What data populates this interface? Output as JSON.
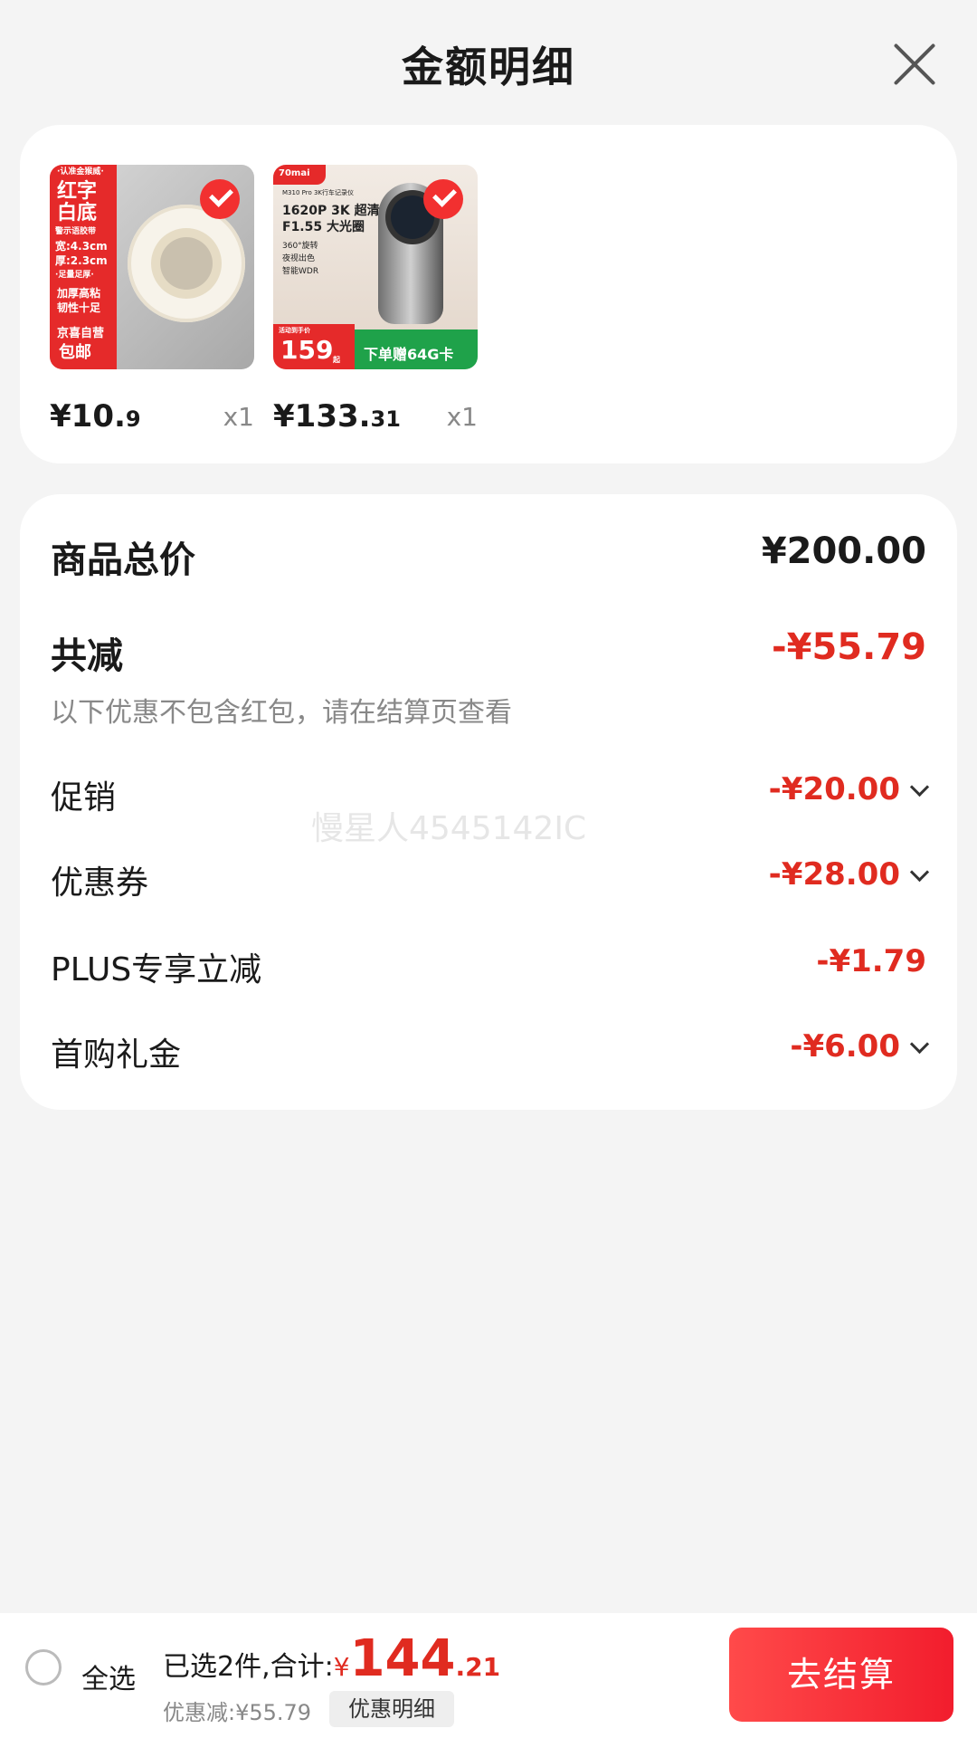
{
  "header": {
    "title": "金额明细"
  },
  "products": [
    {
      "price_int": "¥10.",
      "price_dec": "9",
      "qty": "x1",
      "image_text": [
        "·认准金猴威·",
        "红字",
        "白底",
        "警示语胶带",
        "宽:4.3cm",
        "厚:2.3cm",
        "·足量足厚·",
        "加厚高粘",
        "韧性十足",
        "京喜自营",
        "包邮"
      ]
    },
    {
      "price_int": "¥133.",
      "price_dec": "31",
      "qty": "x1",
      "image_text": [
        "70mai",
        "M310 Pro 3K行车记录仪",
        "1620P 3K 超清",
        "F1.55 大光圈",
        "360°旋转",
        "夜视出色",
        "智能WDR",
        "活动到手价",
        "159",
        "起",
        "下单赠64G卡"
      ]
    }
  ],
  "summary": {
    "total_label": "商品总价",
    "total_value": "¥200.00",
    "reduce_label": "共减",
    "reduce_value": "-¥55.79",
    "note": "以下优惠不包含红包，请在结算页查看",
    "items": [
      {
        "label": "促销",
        "value": "-¥20.00"
      },
      {
        "label": "优惠券",
        "value": "-¥28.00"
      },
      {
        "label": "PLUS专享立减",
        "value": "-¥1.79"
      },
      {
        "label": "首购礼金",
        "value": "-¥6.00"
      }
    ],
    "watermark": "慢星人4545142IC"
  },
  "footer": {
    "select_all": "全选",
    "selected_text": "已选2件,合计:",
    "currency": "¥",
    "total_int": "144",
    "total_dec": ".21",
    "saved_text": "优惠减:¥55.79",
    "detail_button": "优惠明细",
    "checkout_button": "去结算"
  },
  "colors": {
    "accent": "#e02b20",
    "button": "#f21d2d"
  }
}
